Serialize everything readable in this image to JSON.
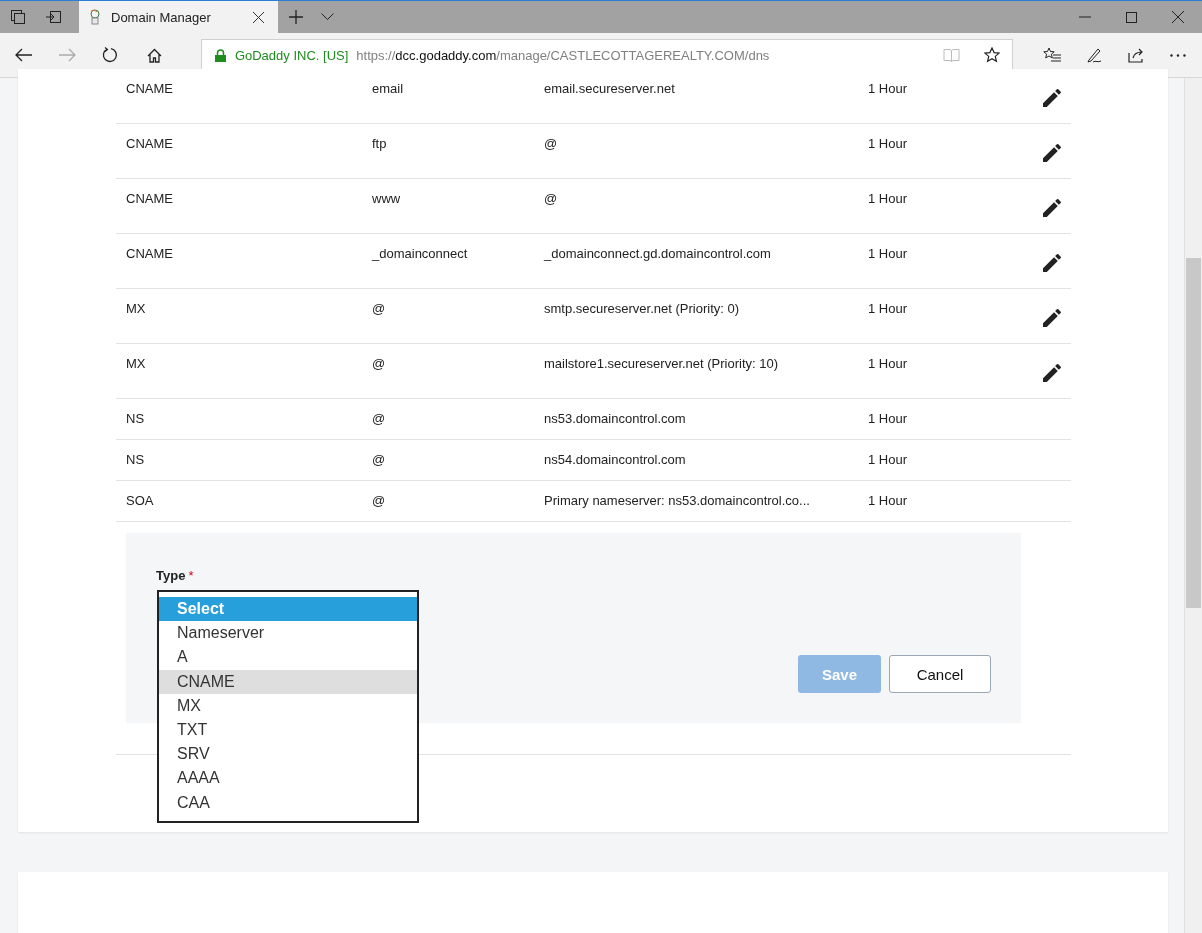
{
  "browser": {
    "tab_title": "Domain Manager",
    "forward_enabled": false,
    "identity": "GoDaddy INC. [US]",
    "url_scheme": "https://",
    "url_host": "dcc.godaddy.com",
    "url_path": "/manage/CASTLECOTTAGEREALTY.COM/dns"
  },
  "records": [
    {
      "type": "CNAME",
      "name": "email",
      "value": "email.secureserver.net",
      "ttl": "1 Hour",
      "editable": true
    },
    {
      "type": "CNAME",
      "name": "ftp",
      "value": "@",
      "ttl": "1 Hour",
      "editable": true
    },
    {
      "type": "CNAME",
      "name": "www",
      "value": "@",
      "ttl": "1 Hour",
      "editable": true
    },
    {
      "type": "CNAME",
      "name": "_domainconnect",
      "value": "_domainconnect.gd.domaincontrol.com",
      "ttl": "1 Hour",
      "editable": true
    },
    {
      "type": "MX",
      "name": "@",
      "value": "smtp.secureserver.net (Priority: 0)",
      "ttl": "1 Hour",
      "editable": true
    },
    {
      "type": "MX",
      "name": "@",
      "value": "mailstore1.secureserver.net (Priority: 10)",
      "ttl": "1 Hour",
      "editable": true
    },
    {
      "type": "NS",
      "name": "@",
      "value": "ns53.domaincontrol.com",
      "ttl": "1 Hour",
      "editable": false
    },
    {
      "type": "NS",
      "name": "@",
      "value": "ns54.domaincontrol.com",
      "ttl": "1 Hour",
      "editable": false
    },
    {
      "type": "SOA",
      "name": "@",
      "value": "Primary nameserver: ns53.domaincontrol.co...",
      "ttl": "1 Hour",
      "editable": false
    }
  ],
  "form": {
    "type_label": "Type",
    "required_mark": "*",
    "type_options": [
      {
        "label": "Select",
        "selected": true,
        "highlighted": false
      },
      {
        "label": "Nameserver",
        "selected": false,
        "highlighted": false
      },
      {
        "label": "A",
        "selected": false,
        "highlighted": false
      },
      {
        "label": "CNAME",
        "selected": false,
        "highlighted": true
      },
      {
        "label": "MX",
        "selected": false,
        "highlighted": false
      },
      {
        "label": "TXT",
        "selected": false,
        "highlighted": false
      },
      {
        "label": "SRV",
        "selected": false,
        "highlighted": false
      },
      {
        "label": "AAAA",
        "selected": false,
        "highlighted": false
      },
      {
        "label": "CAA",
        "selected": false,
        "highlighted": false
      }
    ],
    "save": {
      "label": "Save",
      "disabled": true
    },
    "cancel": {
      "label": "Cancel"
    }
  }
}
